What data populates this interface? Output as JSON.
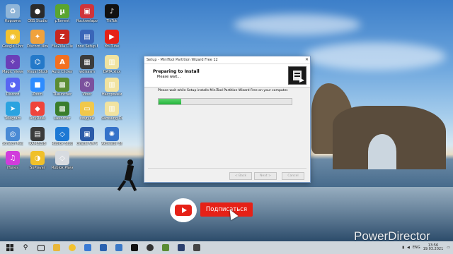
{
  "desktop": {
    "icons": [
      {
        "label": "Корзина",
        "icon": "recycle-bin-icon",
        "color": "#8fb5d8",
        "glyph": "♻"
      },
      {
        "label": "OBS Studio",
        "icon": "obs-icon",
        "color": "#2b2b2b",
        "glyph": "●"
      },
      {
        "label": "µTorrent",
        "icon": "utorrent-icon",
        "color": "#5aa530",
        "glyph": "µ"
      },
      {
        "label": "Rockwelapo...",
        "icon": "folder-icon",
        "color": "#d0343a",
        "glyph": "▣"
      },
      {
        "label": "TikTok",
        "icon": "tiktok-icon",
        "color": "#111111",
        "glyph": "♪"
      },
      {
        "label": "Google Chrome",
        "icon": "chrome-icon",
        "color": "#f2c230",
        "glyph": "◉"
      },
      {
        "label": "Discord Ninety",
        "icon": "app-icon",
        "color": "#f0a23c",
        "glyph": "✦"
      },
      {
        "label": "FileZilla Client",
        "icon": "filezilla-icon",
        "color": "#c7261e",
        "glyph": "Z"
      },
      {
        "label": "Inno Setup Edit",
        "icon": "innosetup-icon",
        "color": "#3a66b8",
        "glyph": "▤"
      },
      {
        "label": "YouTube",
        "icon": "youtube-icon",
        "color": "#e62117",
        "glyph": "▶"
      },
      {
        "label": "Magic Viewer",
        "icon": "magic-icon",
        "color": "#6a3fb8",
        "glyph": "✧"
      },
      {
        "label": "Visual Studio Code",
        "icon": "vscode-icon",
        "color": "#2479c9",
        "glyph": "⌬"
      },
      {
        "label": "Auto Clicker",
        "icon": "autoclicker-icon",
        "color": "#f37021",
        "glyph": "A"
      },
      {
        "label": "wdisasm",
        "icon": "wdisasm-icon",
        "color": "#3c3c3c",
        "glyph": "▦"
      },
      {
        "label": "DATA.xlsx",
        "icon": "file-icon",
        "color": "#f1e3a0",
        "glyph": "▥"
      },
      {
        "label": "Discord",
        "icon": "discord-icon",
        "color": "#5865f2",
        "glyph": "◕"
      },
      {
        "label": "Zoom",
        "icon": "zoom-icon",
        "color": "#2d8cff",
        "glyph": "■"
      },
      {
        "label": "TLauncher",
        "icon": "minecraft-icon",
        "color": "#5b8c34",
        "glyph": "▩"
      },
      {
        "label": "Viber",
        "icon": "viber-icon",
        "color": "#7b519d",
        "glyph": "✆"
      },
      {
        "label": "Настройки",
        "icon": "settings-file-icon",
        "color": "#f1e3a0",
        "glyph": "▥"
      },
      {
        "label": "Telegram",
        "icon": "telegram-icon",
        "color": "#2aa3e0",
        "glyph": "➤"
      },
      {
        "label": "AnyDesk",
        "icon": "anydesk-icon",
        "color": "#ef443b",
        "glyph": "◆"
      },
      {
        "label": "Launcher",
        "icon": "launcher-icon",
        "color": "#3a7d2c",
        "glyph": "▩"
      },
      {
        "label": "модули",
        "icon": "folder-icon",
        "color": "#f1c84b",
        "glyph": "▭"
      },
      {
        "label": "Samsung DeX",
        "icon": "file-icon",
        "color": "#f1e3a0",
        "glyph": "▥"
      },
      {
        "label": "Scratch Mess",
        "icon": "scratch-icon",
        "color": "#4a8ad4",
        "glyph": "◎"
      },
      {
        "label": "RAM2LSB",
        "icon": "ram-icon",
        "color": "#3b3b3b",
        "glyph": "▤"
      },
      {
        "label": "Roblox Studio",
        "icon": "roblox-icon",
        "color": "#1d78d4",
        "glyph": "◇"
      },
      {
        "label": "Oracle VM VirtualBox",
        "icon": "virtualbox-icon",
        "color": "#2b5aa8",
        "glyph": "▣"
      },
      {
        "label": "Aktivator ShaeAreDL",
        "icon": "app-icon",
        "color": "#3572c9",
        "glyph": "✺"
      },
      {
        "label": "iTunes",
        "icon": "itunes-icon",
        "color": "#d13ddc",
        "glyph": "♫"
      },
      {
        "label": "SoPlayer",
        "icon": "soplayer-icon",
        "color": "#f0c02a",
        "glyph": "◑"
      },
      {
        "label": "Roblox Player",
        "icon": "roblox-player-icon",
        "color": "#d7dbe0",
        "glyph": "◇"
      }
    ]
  },
  "installer": {
    "title": "Setup - MiniTool Partition Wizard Free 12",
    "heading": "Preparing to Install",
    "subheading": "Please wait...",
    "message": "Please wait while Setup installs MiniTool Partition Wizard Free on your computer.",
    "progress": 0.17,
    "back_label": "< Back",
    "next_label": "Next >",
    "cancel_label": "Cancel"
  },
  "overlay": {
    "subscribe_label": "Подписаться",
    "watermark": "PowerDirector"
  },
  "taskbar": {
    "tray_lang": "ENG",
    "tray_time": "13:56",
    "tray_date": "19.03.2021"
  }
}
